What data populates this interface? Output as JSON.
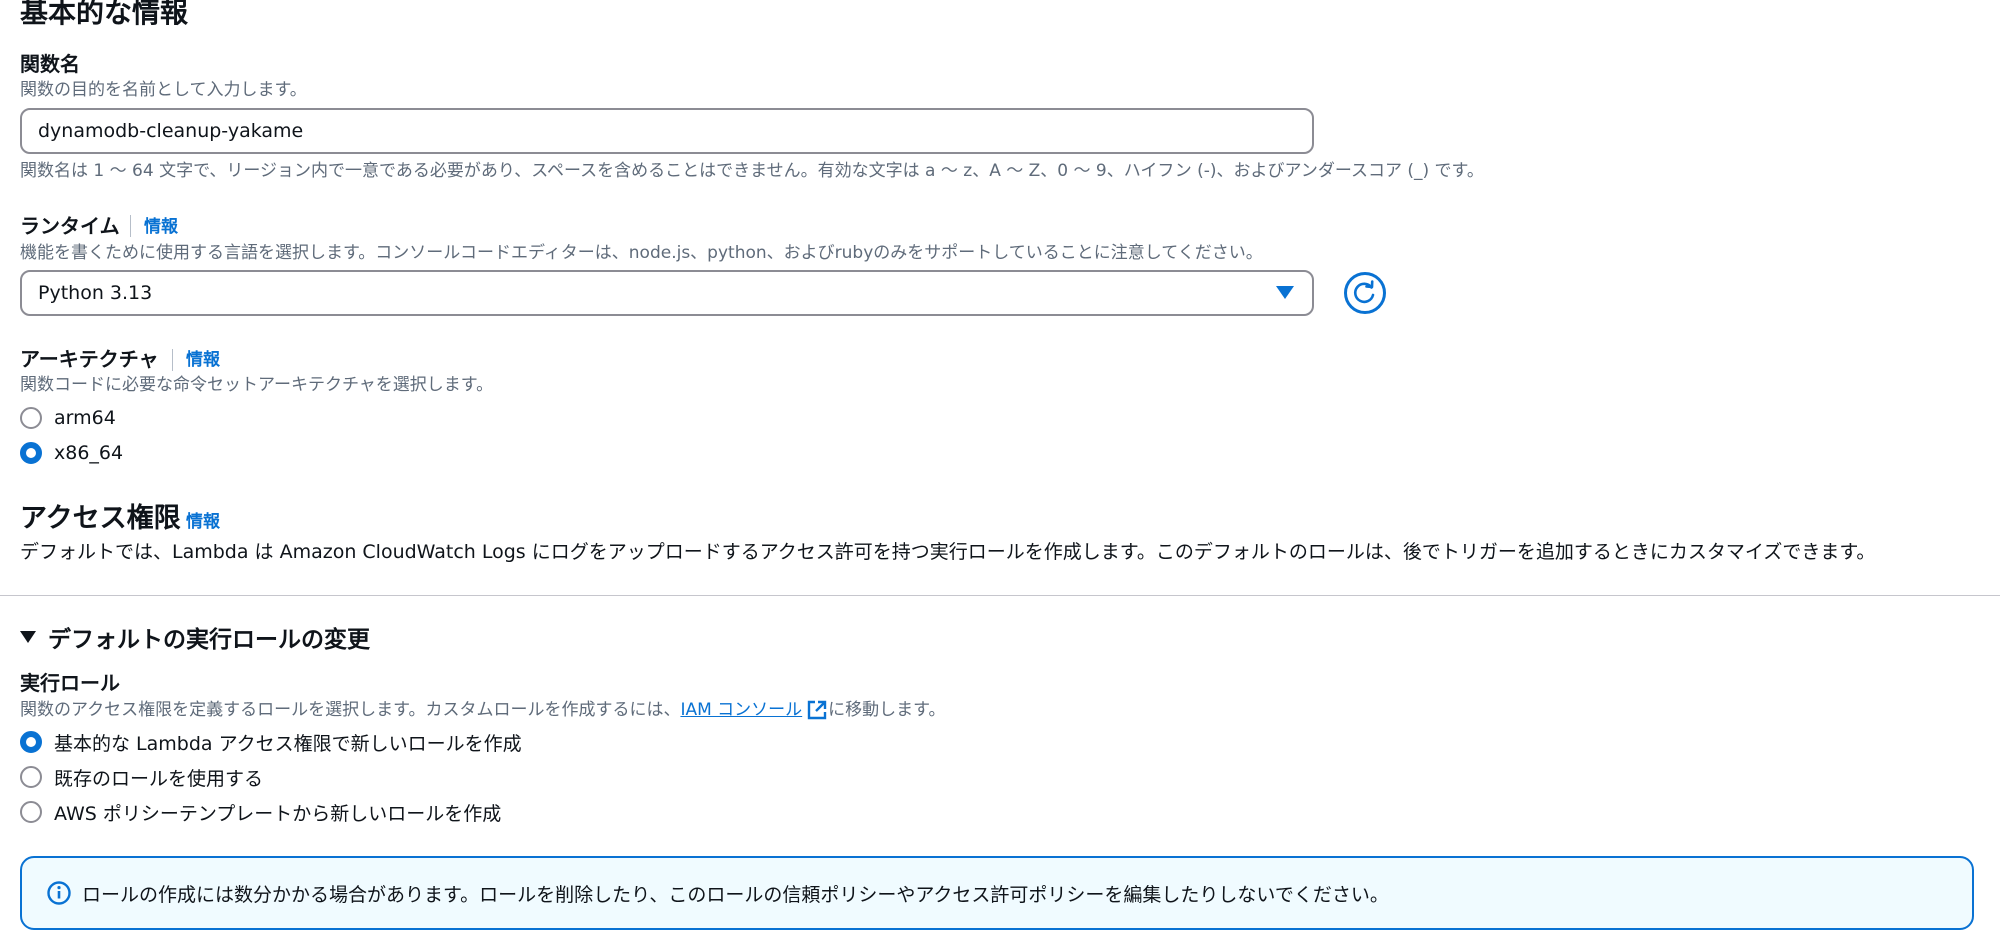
{
  "basic_info": {
    "title": "基本的な情報"
  },
  "function_name": {
    "label": "関数名",
    "description": "関数の目的を名前として入力します。",
    "value": "dynamodb-cleanup-yakame",
    "constraint": "関数名は 1 〜 64 文字で、リージョン内で一意である必要があり、スペースを含めることはできません。有効な文字は a 〜 z、A 〜 Z、0 〜 9、ハイフン (-)、およびアンダースコア (_) です。"
  },
  "runtime": {
    "label": "ランタイム",
    "info": "情報",
    "description": "機能を書くために使用する言語を選択します。コンソールコードエディターは、node.js、python、およびrubyのみをサポートしていることに注意してください。",
    "selected": "Python 3.13",
    "refresh_icon": "refresh-icon"
  },
  "architecture": {
    "label": "アーキテクチャ",
    "info": "情報",
    "description": "関数コードに必要な命令セットアーキテクチャを選択します。",
    "options": [
      {
        "label": "arm64",
        "checked": false
      },
      {
        "label": "x86_64",
        "checked": true
      }
    ]
  },
  "permissions": {
    "title": "アクセス権限",
    "info": "情報",
    "description": "デフォルトでは、Lambda は Amazon CloudWatch Logs にログをアップロードするアクセス許可を持つ実行ロールを作成します。このデフォルトのロールは、後でトリガーを追加するときにカスタマイズできます。"
  },
  "execution_role_section": {
    "expander_label": "デフォルトの実行ロールの変更",
    "label": "実行ロール",
    "description_before": "関数のアクセス権限を定義するロールを選択します。カスタムロールを作成するには、",
    "link_text": "IAM コンソール",
    "description_after": "に移動します。",
    "options": [
      {
        "label": "基本的な Lambda アクセス権限で新しいロールを作成",
        "checked": true
      },
      {
        "label": "既存のロールを使用する",
        "checked": false
      },
      {
        "label": "AWS ポリシーテンプレートから新しいロールを作成",
        "checked": false
      }
    ]
  },
  "alert": {
    "icon": "info-icon",
    "text": "ロールの作成には数分かかる場合があります。ロールを削除したり、このロールの信頼ポリシーやアクセス許可ポリシーを編集したりしないでください。"
  },
  "colors": {
    "accent": "#0972d3",
    "text": "#0f141a",
    "muted": "#5f6b7a",
    "alert_bg": "#f0fbff"
  }
}
